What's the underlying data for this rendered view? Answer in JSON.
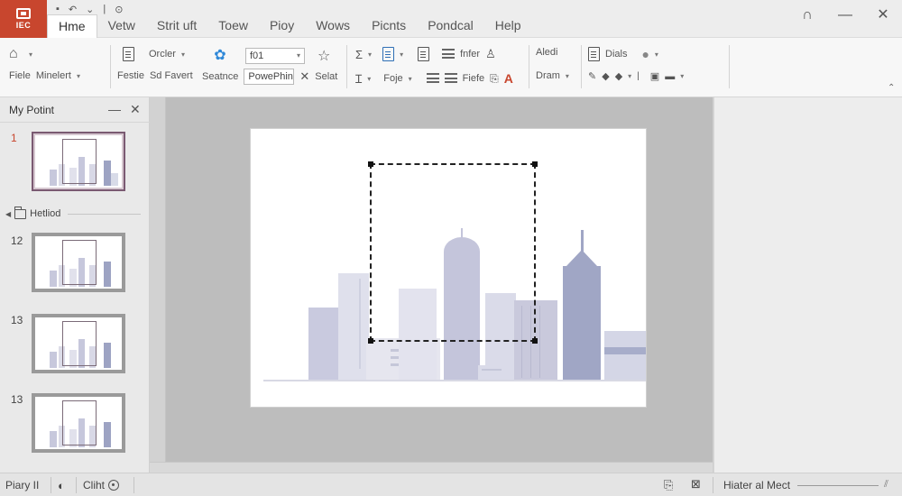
{
  "app": {
    "badge_text": "IEC",
    "accent_color": "#c8462e"
  },
  "quick_access": {
    "save_icon": "save-icon",
    "undo_icon": "undo-icon",
    "redo_icon": "redo-icon"
  },
  "tabs": [
    {
      "label": "Hme",
      "active": true
    },
    {
      "label": "Vetw"
    },
    {
      "label": "Strit uft"
    },
    {
      "label": "Toew"
    },
    {
      "label": "Pioy"
    },
    {
      "label": "Wows"
    },
    {
      "label": "Picnts"
    },
    {
      "label": "Pondcal"
    },
    {
      "label": "Help"
    }
  ],
  "window": {
    "restore_glyph": "∩",
    "minimize_glyph": "—",
    "close_glyph": "✕"
  },
  "ribbon": {
    "group1": {
      "top_icon": "home-icon",
      "label_a": "Fiele",
      "label_b": "Minelert"
    },
    "group2": {
      "orcler": "Orcler",
      "festie": "Festie",
      "sd_favert": "Sd Favert"
    },
    "group3": {
      "seatnce": "Seatnce",
      "font_size": "f01",
      "font_name": "PowePhin",
      "select": "Selat"
    },
    "group4": {
      "fnfer": "fnfer",
      "fiefe": "Fiefe",
      "foje": "Foje"
    },
    "group5": {
      "aledi": "Aledi",
      "dram": "Dram"
    },
    "group6": {
      "dials": "Dials"
    }
  },
  "leftpane": {
    "title": "My Potint",
    "section_label": "Hetliod",
    "slides": [
      {
        "num": "1",
        "selected": true
      },
      {
        "num": "12"
      },
      {
        "num": "13"
      },
      {
        "num": "13"
      }
    ]
  },
  "statusbar": {
    "slide_info": "Piary II",
    "notes": "Cliht",
    "right_text": "Hiater al Mect"
  }
}
